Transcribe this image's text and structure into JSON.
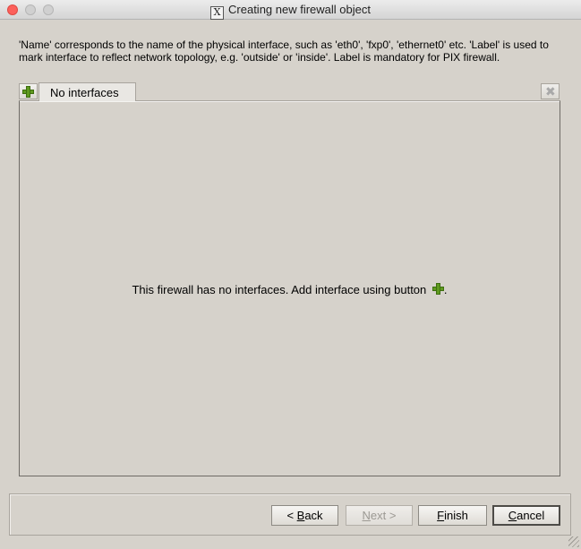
{
  "window": {
    "title": "Creating new firewall object",
    "title_icon_glyph": "X"
  },
  "description": "'Name' corresponds to the name of the physical interface, such as 'eth0', 'fxp0', 'ethernet0' etc. 'Label' is used to mark interface to reflect network topology, e.g. 'outside' or 'inside'. Label is mandatory for PIX firewall.",
  "tabs": {
    "active_label": "No interfaces"
  },
  "pane": {
    "message_prefix": "This firewall has no interfaces. Add interface using button",
    "message_suffix": "."
  },
  "buttons": {
    "back": {
      "prefix": "< ",
      "mnemonic": "B",
      "rest": "ack"
    },
    "next": {
      "mnemonic": "N",
      "rest": "ext >"
    },
    "finish": {
      "mnemonic": "F",
      "rest": "inish"
    },
    "cancel": {
      "mnemonic": "C",
      "rest": "ancel"
    }
  },
  "colors": {
    "background": "#d6d2cb",
    "close_button": "#fc605b",
    "plus_icon": "#5f9a1f"
  },
  "icons": {
    "add": "plus-icon",
    "delete": "close-icon",
    "window": "x11-icon"
  }
}
